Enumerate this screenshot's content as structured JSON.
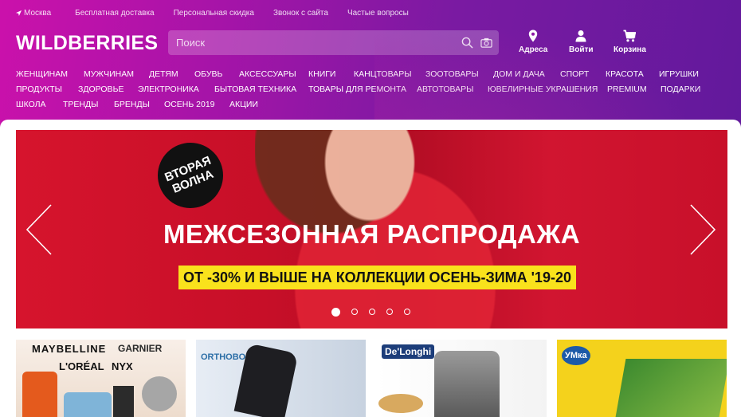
{
  "topbar": {
    "location": "Москва",
    "links": [
      "Бесплатная доставка",
      "Персональная скидка",
      "Звонок с сайта",
      "Частые вопросы"
    ]
  },
  "logo": "WILDBERRIES",
  "search": {
    "placeholder": "Поиск"
  },
  "header_actions": [
    {
      "label": "Адреса",
      "icon": "pin-icon"
    },
    {
      "label": "Войти",
      "icon": "user-icon"
    },
    {
      "label": "Корзина",
      "icon": "cart-icon"
    }
  ],
  "nav": {
    "row1": [
      "Женщинам",
      "Мужчинам",
      "Детям",
      "Обувь",
      "Аксессуары",
      "Книги",
      "Канцтовары",
      "Зоотовары",
      "Дом и дача",
      "Спорт",
      "Красота",
      "Игрушки"
    ],
    "row2": [
      "Продукты",
      "Здоровье",
      "Электроника",
      "Бытовая техника",
      "Товары для ремонта",
      "Автотовары",
      "Ювелирные украшения",
      "Premium",
      "Подарки"
    ],
    "row3": [
      "Школа",
      "Тренды",
      "Бренды",
      "Осень 2019",
      "Акции"
    ]
  },
  "banner": {
    "badge": "ВТОРАЯ ВОЛНА",
    "headline": "МЕЖСЕЗОННАЯ РАСПРОДАЖА",
    "subline": "ОТ -30% И ВЫШЕ НА КОЛЛЕКЦИИ ОСЕНЬ-ЗИМА '19-20",
    "slides": 5,
    "active_slide": 1
  },
  "tiles": [
    {
      "brands": [
        "MAYBELLINE",
        "GARNIER",
        "L'ORÉAL",
        "NYX"
      ]
    },
    {
      "brands": [
        "ORTHOBOOM"
      ]
    },
    {
      "brands": [
        "De'Longhi"
      ]
    },
    {
      "brands": [
        "УМка"
      ]
    }
  ],
  "colors": {
    "header_start": "#cb11ab",
    "header_end": "#62199c",
    "banner_red": "#c8102a",
    "banner_yellow": "#f9e21c"
  }
}
